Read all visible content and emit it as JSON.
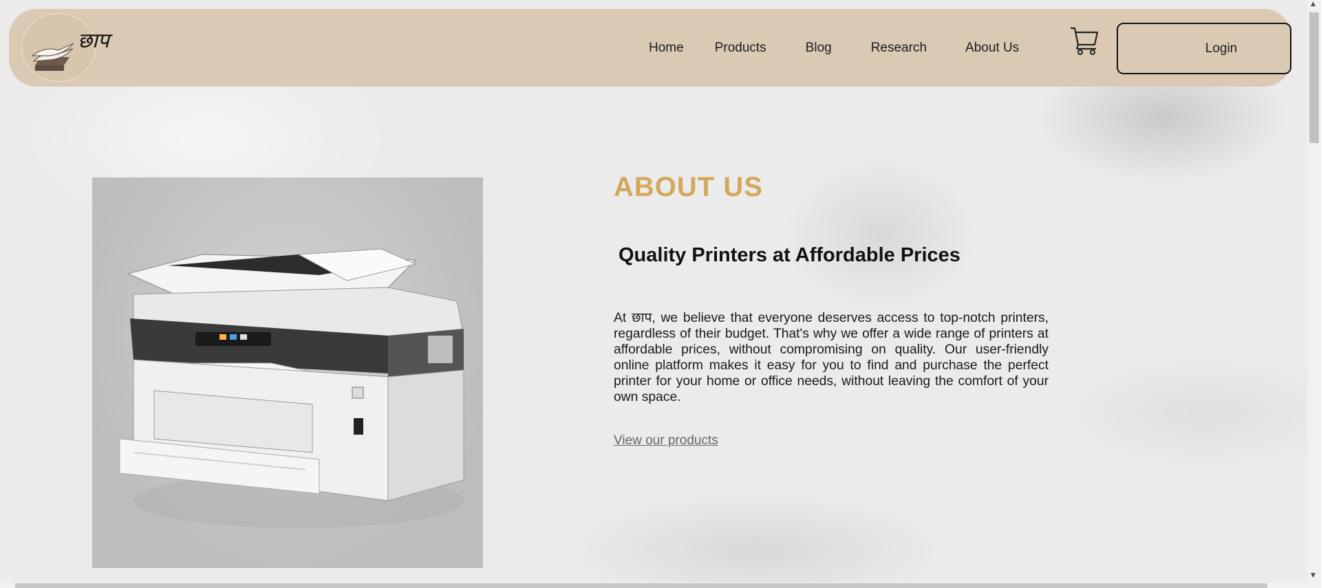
{
  "brand": {
    "logo_text": "छाप"
  },
  "nav": {
    "items": [
      {
        "label": "Home"
      },
      {
        "label": "Products"
      },
      {
        "label": "Blog"
      },
      {
        "label": "Research"
      },
      {
        "label": "About Us"
      }
    ],
    "cart_icon": "cart-icon",
    "login_label": "Login"
  },
  "about": {
    "heading": "ABOUT US",
    "subheading": "Quality Printers at Affordable Prices",
    "paragraph": "At छाप, we believe that everyone deserves access to top-notch printers, regardless of their budget. That's why we offer a wide range of printers at affordable prices, without compromising on quality. Our user-friendly online platform makes it easy for you to find and purchase the perfect printer for your home or office needs, without leaving the comfort of your own space.",
    "link_label": "View our products"
  },
  "colors": {
    "navbar_bg": "#dbcab3",
    "heading_accent": "#d4a85c",
    "page_bg": "#ebebeb"
  }
}
